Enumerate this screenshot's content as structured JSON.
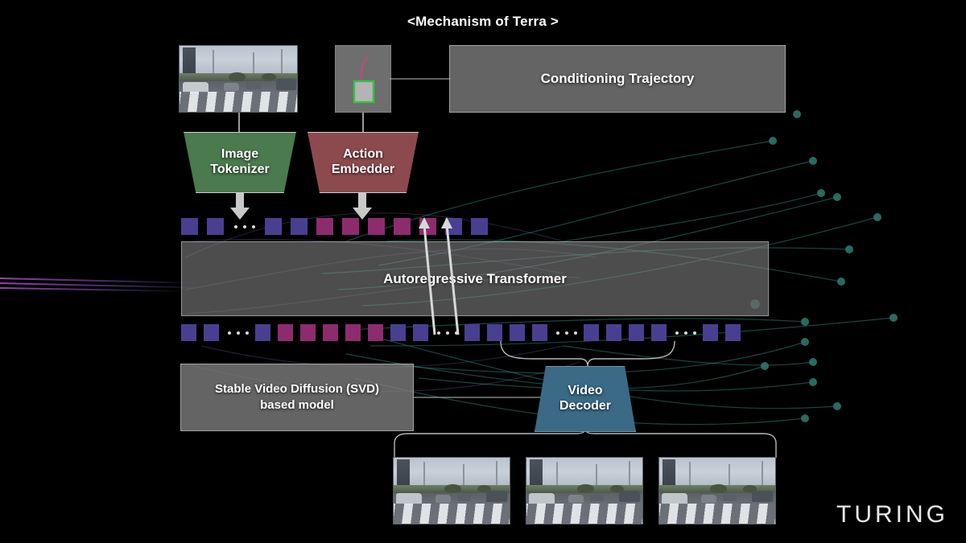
{
  "title": "<Mechanism of Terra >",
  "brand": {
    "logo_text": "TURING"
  },
  "colors": {
    "token_purple": "#493f91",
    "token_magenta": "#8d2c6d",
    "image_tokenizer": "#4a7a4e",
    "action_embedder": "#8c4a4f",
    "video_decoder": "#3a6a86",
    "gray_box": "#808080",
    "flow_teal": "#2e7d72",
    "flow_purple": "#6f4fa8",
    "background": "#000000"
  },
  "nodes": {
    "input_frame": {
      "label": "input-driving-frame"
    },
    "action_frame": {
      "label": "action-trajectory-frame"
    },
    "conditioning_trajectory": {
      "label": "Conditioning Trajectory"
    },
    "image_tokenizer": {
      "line1": "Image",
      "line2": "Tokenizer"
    },
    "action_embedder": {
      "line1": "Action",
      "line2": "Embedder"
    },
    "transformer": {
      "label": "Autoregressive Transformer"
    },
    "svd_model": {
      "line1": "Stable Video Diffusion (SVD)",
      "line2": "based model"
    },
    "video_decoder": {
      "line1": "Video",
      "line2": "Decoder"
    }
  },
  "token_rows": {
    "input_row": {
      "name": "input-token-sequence",
      "groups": [
        {
          "type": "tokens",
          "color": "purple",
          "count": 2
        },
        {
          "type": "ellipsis",
          "count": 3
        },
        {
          "type": "tokens",
          "color": "purple",
          "count": 2
        },
        {
          "type": "tokens",
          "color": "magenta",
          "count": 5
        },
        {
          "type": "tokens",
          "color": "purple",
          "count": 2
        }
      ]
    },
    "output_row": {
      "name": "output-token-sequence",
      "groups": [
        {
          "type": "tokens",
          "color": "purple",
          "count": 2
        },
        {
          "type": "ellipsis",
          "count": 3
        },
        {
          "type": "tokens",
          "color": "purple",
          "count": 1
        },
        {
          "type": "tokens",
          "color": "magenta",
          "count": 5
        },
        {
          "type": "tokens",
          "color": "purple",
          "count": 2
        },
        {
          "type": "ellipsis",
          "count": 3
        },
        {
          "type": "tokens",
          "color": "purple",
          "count": 4
        },
        {
          "type": "ellipsis",
          "count": 3
        },
        {
          "type": "tokens",
          "color": "purple",
          "count": 4
        },
        {
          "type": "ellipsis",
          "count": 3
        },
        {
          "type": "tokens",
          "color": "purple",
          "count": 2
        }
      ]
    }
  },
  "output_frames": [
    {
      "label": "generated-frame-1"
    },
    {
      "label": "generated-frame-2"
    },
    {
      "label": "generated-frame-3"
    }
  ]
}
